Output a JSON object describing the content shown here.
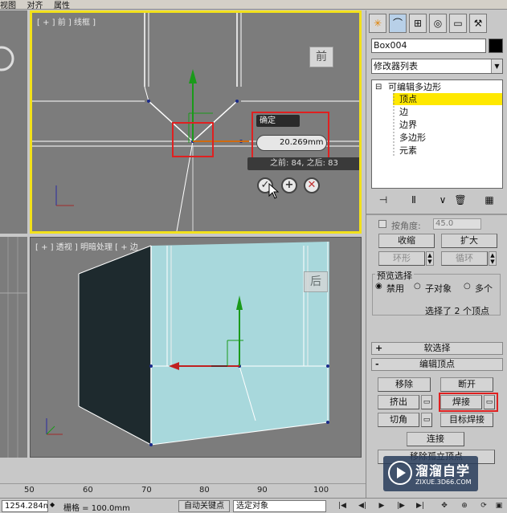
{
  "menu": [
    "视图",
    "对齐",
    "属性"
  ],
  "viewports": {
    "front_label": "[ + ] 前 ] 线框 ]",
    "persp_label": "[ + ] 透视 ] 明暗处理 [ + 边",
    "front_cube": "前",
    "persp_cube": "后"
  },
  "weld_caddy": {
    "title": "确定",
    "threshold": "20.269mm",
    "info": "之前: 84, 之后: 83",
    "ok_icon": "✓",
    "apply_icon": "+",
    "cancel_icon": "✕"
  },
  "ruler": {
    "ticks": [
      "50",
      "60",
      "70",
      "80",
      "90",
      "100"
    ]
  },
  "statusbar": {
    "coord": "1254.284m",
    "grid": "栅格 = 100.0mm",
    "auto_key": "自动关键点",
    "selection": "选定对象"
  },
  "panel": {
    "tab_icons": [
      "sun-icon",
      "curve-icon",
      "hierarchy-icon",
      "motion-icon",
      "display-icon",
      "utilities-icon"
    ],
    "object_name": "Box004",
    "modifier_list": "修改器列表",
    "stack": {
      "root": "可编辑多边形",
      "levels": [
        "顶点",
        "边",
        "边界",
        "多边形",
        "元素"
      ],
      "active": "顶点"
    },
    "selection": {
      "by_angle": "按角度:",
      "angle_value": "45.0",
      "shrink": "收缩",
      "grow": "扩大",
      "ring": "环形",
      "loop": "循环",
      "preview_label": "预览选择",
      "disabled": "禁用",
      "sub_object": "子对象",
      "multiple": "多个",
      "status": "选择了 2 个顶点"
    },
    "soft_selection": "软选择",
    "edit_vertices": {
      "title": "编辑顶点",
      "remove": "移除",
      "break": "断开",
      "extrude": "挤出",
      "weld": "焊接",
      "chamfer": "切角",
      "target_weld": "目标焊接",
      "connect": "连接",
      "remove_isolated": "移除孤立顶点"
    }
  },
  "watermark": {
    "brand": "溜溜自学",
    "url": "ZIXUE.3D66.COM"
  }
}
